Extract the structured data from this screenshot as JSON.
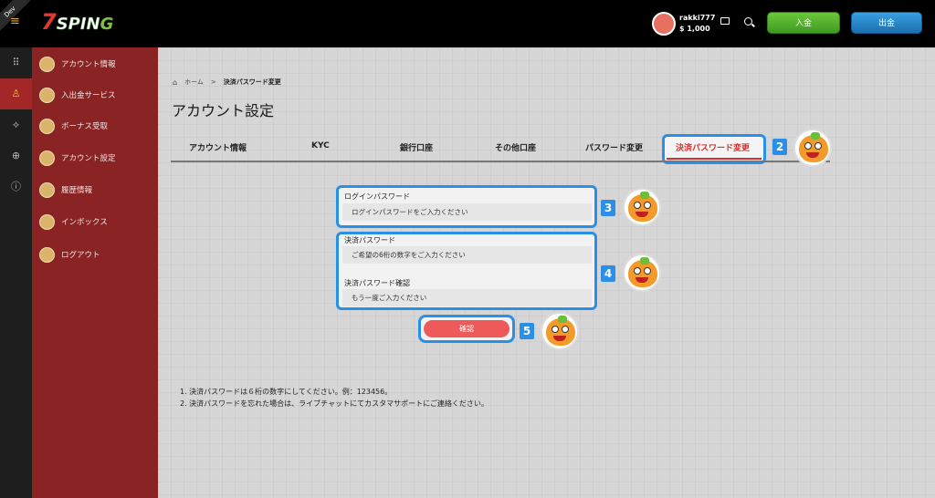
{
  "header": {
    "dev_badge": "Dev",
    "logo_text_a": "7",
    "logo_text_b": "SPIN",
    "logo_text_c": "G",
    "username": "rakki777",
    "balance": "$ 1,000",
    "deposit_label": "入金",
    "withdraw_label": "出金"
  },
  "sidebar": {
    "items": [
      {
        "label": "アカウント情報"
      },
      {
        "label": "入出金サービス"
      },
      {
        "label": "ボーナス受取"
      },
      {
        "label": "アカウント設定"
      },
      {
        "label": "履歴情報"
      },
      {
        "label": "インボックス"
      },
      {
        "label": "ログアウト"
      }
    ]
  },
  "breadcrumb": {
    "home": "ホーム",
    "sep": ">",
    "current": "決済パスワード変更"
  },
  "page_title": "アカウント設定",
  "tabs": [
    {
      "label": "アカウント情報"
    },
    {
      "label": "KYC"
    },
    {
      "label": "銀行口座"
    },
    {
      "label": "その他口座"
    },
    {
      "label": "パスワード変更"
    },
    {
      "label": "決済パスワード変更"
    }
  ],
  "form": {
    "login_password_label": "ログインパスワード",
    "login_password_placeholder": "ログインパスワードをご入力ください",
    "payment_password_label": "決済パスワード",
    "payment_password_placeholder": "ご希望の6桁の数字をご入力ください",
    "payment_password_confirm_label": "決済パスワード確認",
    "payment_password_confirm_placeholder": "もう一度ご入力ください",
    "confirm_label": "確認"
  },
  "steps": [
    "2",
    "3",
    "4",
    "5"
  ],
  "notes": [
    "1. 決済パスワードは６桁の数字にしてください。例：123456。",
    "2. 決済パスワードを忘れた場合は、ライブチャットにてカスタマサポートにご連絡ください。"
  ],
  "colors": {
    "accent_blue": "#2a8fe6",
    "sidebar_red": "#8a2323",
    "active_red": "#d23030",
    "confirm_red": "#ee5a5a"
  }
}
